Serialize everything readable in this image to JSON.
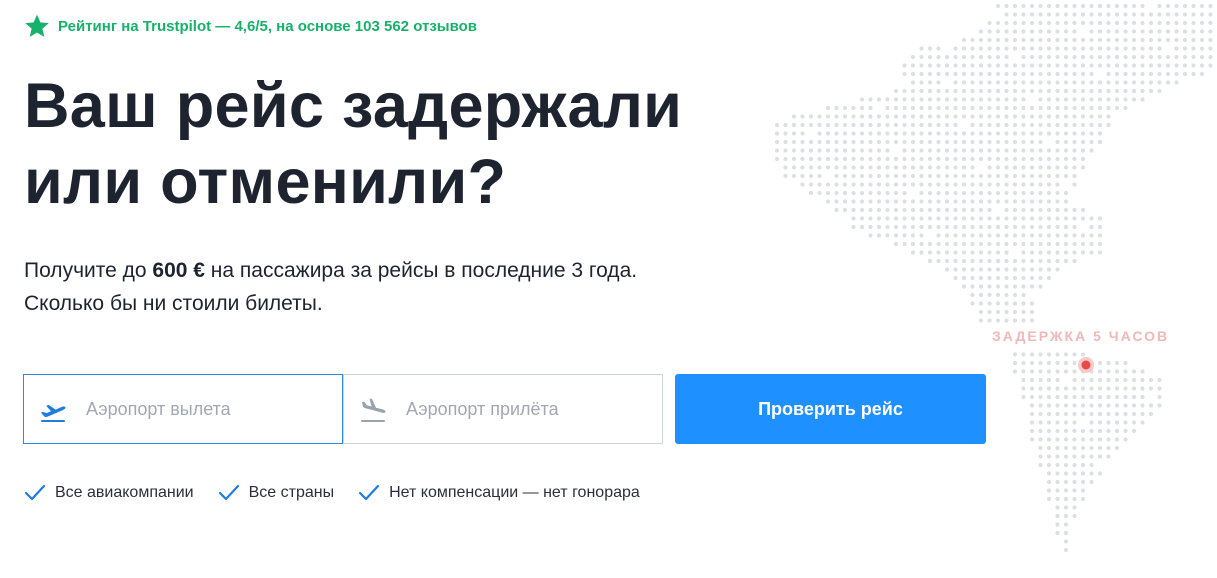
{
  "rating": {
    "text": "Рейтинг на Trustpilot — 4,6/5, на основе 103 562 отзывов",
    "icon": "star-icon",
    "color": "#17b26a"
  },
  "hero": {
    "title_line1": "Ваш рейс задержали",
    "title_line2": "или отменили?",
    "subtitle_line1_before": "Получите до ",
    "subtitle_line1_bold": "600 €",
    "subtitle_line1_after": " на пассажира за рейсы в последние 3 года.",
    "subtitle_line2": "Сколько бы ни стоили билеты."
  },
  "form": {
    "departure": {
      "placeholder": "Аэропорт вылета",
      "value": "",
      "icon": "plane-takeoff-icon"
    },
    "arrival": {
      "placeholder": "Аэропорт прилёта",
      "value": "",
      "icon": "plane-landing-icon"
    },
    "submit_label": "Проверить рейс"
  },
  "features": [
    {
      "label": "Все авиакомпании",
      "icon": "checkmark-icon"
    },
    {
      "label": "Все страны",
      "icon": "checkmark-icon"
    },
    {
      "label": "Нет компенсации — нет гонорара",
      "icon": "checkmark-icon"
    }
  ],
  "map": {
    "delay_label": "ЗАДЕРЖКА 5 ЧАСОВ"
  },
  "colors": {
    "accent": "#1e90ff",
    "text": "#1e2330",
    "trustpilot": "#17b26a",
    "delay_dot": "#e84a4a"
  }
}
